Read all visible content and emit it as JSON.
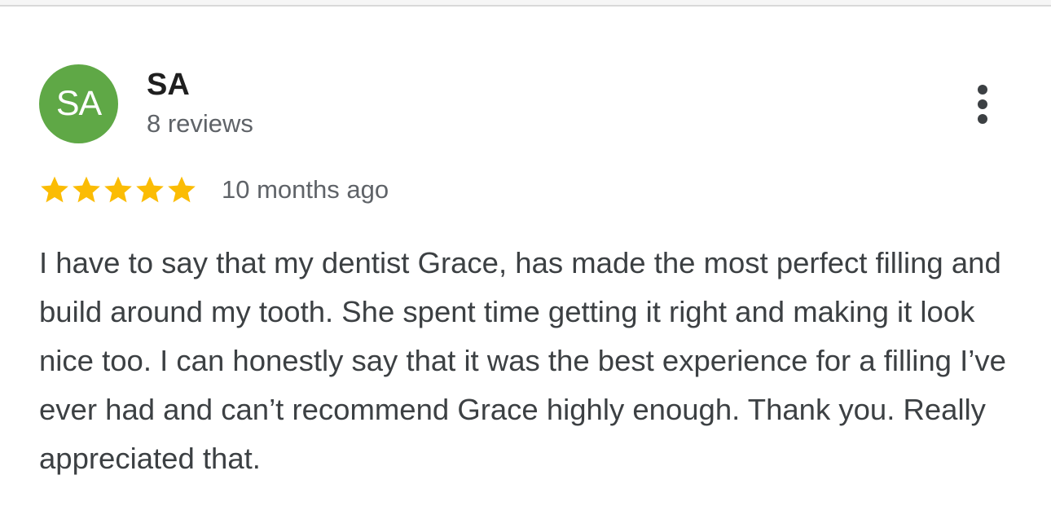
{
  "review": {
    "avatar_initials": "SA",
    "avatar_color": "#5fa846",
    "reviewer_name": "SA",
    "reviewer_review_count": "8 reviews",
    "more_icon": "more-vertical-icon",
    "rating": 5,
    "rating_max": 5,
    "star_color": "#fbbc04",
    "date": "10 months ago",
    "text": "I have to say that my dentist Grace, has made the most perfect filling and build around my tooth. She spent time getting it right and making it look nice too. I can honestly say that it was the best experience for a filling I’ve ever had and can’t recommend Grace highly enough. Thank you. Really appreciated that."
  }
}
